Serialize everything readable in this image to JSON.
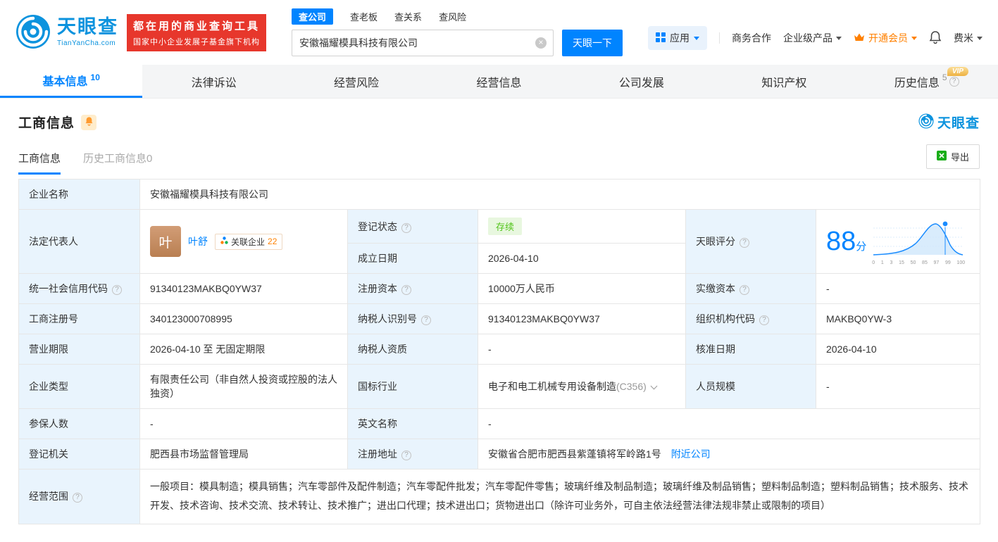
{
  "brand": {
    "name": "天眼查",
    "domain": "TianYanCha.com",
    "primary_color": "#0084ff"
  },
  "banner": {
    "line1": "都在用的商业查询工具",
    "line2": "国家中小企业发展子基金旗下机构",
    "bg_color": "#e7372c"
  },
  "search": {
    "tabs": [
      {
        "label": "查公司",
        "active": true
      },
      {
        "label": "查老板",
        "active": false
      },
      {
        "label": "查关系",
        "active": false
      },
      {
        "label": "查风险",
        "active": false
      }
    ],
    "query": "安徽福耀模具科技有限公司",
    "button_label": "天眼一下"
  },
  "top_nav": {
    "app": "应用",
    "biz_cooperation": "商务合作",
    "enterprise_products": "企业级产品",
    "vip": "开通会员",
    "username": "费米"
  },
  "main_tabs": [
    {
      "label": "基本信息",
      "count": "10",
      "active": true
    },
    {
      "label": "法律诉讼"
    },
    {
      "label": "经营风险"
    },
    {
      "label": "经营信息"
    },
    {
      "label": "公司发展"
    },
    {
      "label": "知识产权"
    },
    {
      "label": "历史信息",
      "count": "5",
      "vip_badge": "VIP"
    }
  ],
  "section": {
    "title": "工商信息",
    "watermark_brand": "天眼查",
    "subtab_active": "工商信息",
    "subtab_history": "历史工商信息0",
    "export_label": "导出"
  },
  "legal_rep": {
    "avatar_char": "叶",
    "name": "叶舒",
    "related_label": "关联企业",
    "related_count": "22"
  },
  "score": {
    "value": "88",
    "unit": "分",
    "axis_ticks": [
      "0",
      "1",
      "3",
      "15",
      "50",
      "85",
      "97",
      "99",
      "100"
    ]
  },
  "fields": {
    "company_name_label": "企业名称",
    "company_name": "安徽福耀模具科技有限公司",
    "legal_rep_label": "法定代表人",
    "reg_status_label": "登记状态",
    "reg_status": "存续",
    "score_label": "天眼评分",
    "est_date_label": "成立日期",
    "est_date": "2026-04-10",
    "credit_code_label": "统一社会信用代码",
    "credit_code": "91340123MAKBQ0YW37",
    "reg_capital_label": "注册资本",
    "reg_capital": "10000万人民币",
    "paid_capital_label": "实缴资本",
    "paid_capital": "-",
    "reg_number_label": "工商注册号",
    "reg_number": "340123000708995",
    "taxpayer_id_label": "纳税人识别号",
    "taxpayer_id": "91340123MAKBQ0YW37",
    "org_code_label": "组织机构代码",
    "org_code": "MAKBQ0YW-3",
    "business_term_label": "营业期限",
    "business_term": "2026-04-10 至 无固定期限",
    "taxpayer_qual_label": "纳税人资质",
    "taxpayer_qual": "-",
    "approval_date_label": "核准日期",
    "approval_date": "2026-04-10",
    "company_type_label": "企业类型",
    "company_type": "有限责任公司（非自然人投资或控股的法人独资）",
    "industry_label": "国标行业",
    "industry_name": "电子和电工机械专用设备制造",
    "industry_code": "(C356)",
    "staff_size_label": "人员规模",
    "staff_size": "-",
    "insured_label": "参保人数",
    "insured_count": "-",
    "english_name_label": "英文名称",
    "english_name": "-",
    "reg_authority_label": "登记机关",
    "reg_authority": "肥西县市场监督管理局",
    "address_label": "注册地址",
    "address": "安徽省合肥市肥西县紫蓬镇将军岭路1号",
    "nearby_link": "附近公司",
    "scope_label": "经营范围",
    "scope": "一般项目：模具制造；模具销售；汽车零部件及配件制造；汽车零配件批发；汽车零配件零售；玻璃纤维及制品制造；玻璃纤维及制品销售；塑料制品制造；塑料制品销售；技术服务、技术开发、技术咨询、技术交流、技术转让、技术推广；进出口代理；技术进出口；货物进出口（除许可业务外，可自主依法经营法律法规非禁止或限制的项目）"
  },
  "icons": {
    "help": "?",
    "clear": "×"
  }
}
